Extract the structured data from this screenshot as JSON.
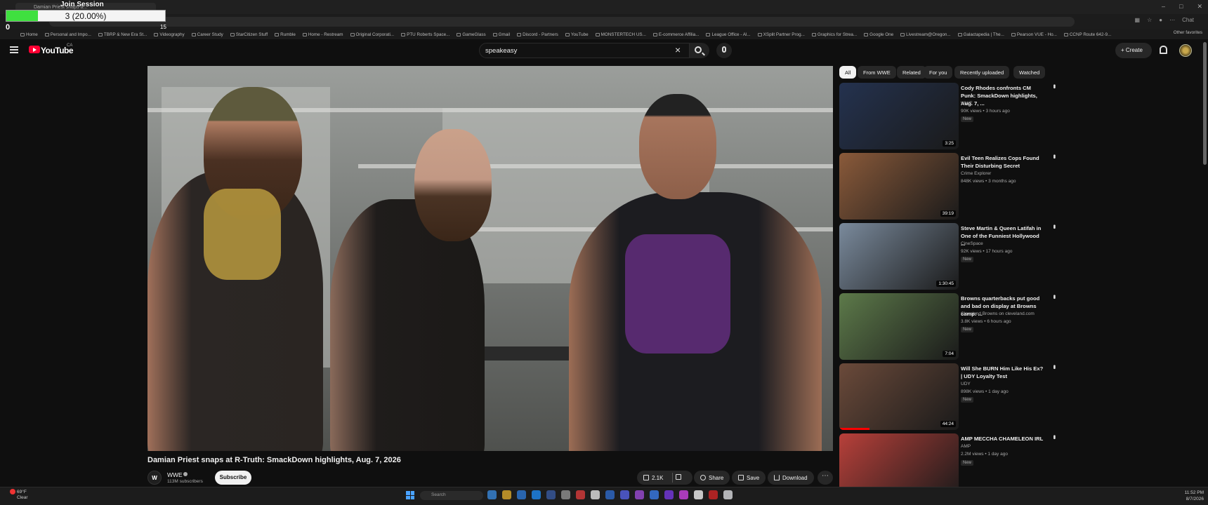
{
  "browser": {
    "tab_title": "Damian Priest snaps a...",
    "bookmarks": [
      "Home",
      "Personal and Impo...",
      "TBRP & New Era St...",
      "Videography",
      "Career Study",
      "StarCitizen Stuff",
      "Rumble",
      "Home - Restream",
      "Original Corporati...",
      "PTU Roberts Space...",
      "GameGlass",
      "Gmail",
      "Discord - Partners",
      "YouTube",
      "MONSTERTECH US...",
      "E-commerce Affilia...",
      "League Office - Al...",
      "XSplit Partner Prog...",
      "Graphics for Strea...",
      "Google One",
      "Livestream@Oregon...",
      "Galactapedia | The...",
      "Pearson VUE - Ho...",
      "CCNP Route 642-9..."
    ],
    "other_bookmarks": "Other favorites",
    "chat_label": "Chat"
  },
  "session": {
    "title": "Join Session",
    "progress_text": "3 (20.00%)",
    "progress_fraction": 0.2,
    "min_label": "0",
    "max_label": "15"
  },
  "youtube": {
    "logo_text": "YouTube",
    "country": "CA",
    "search_query": "speakeasy",
    "create_label": "Create"
  },
  "video": {
    "title": "Damian Priest snaps at R-Truth: SmackDown highlights, Aug. 7, 2026",
    "channel": "WWE",
    "subscribers": "113M subscribers",
    "subscribe_label": "Subscribe",
    "likes": "2.1K",
    "share_label": "Share",
    "save_label": "Save",
    "download_label": "Download"
  },
  "chips": [
    "All",
    "From WWE",
    "Related",
    "For you",
    "Recently uploaded",
    "Watched"
  ],
  "recommendations": [
    {
      "title": "Cody Rhodes confronts CM Punk: SmackDown highlights, Aug. 7, ...",
      "channel": "WWE",
      "meta": "90K views • 3 hours ago",
      "badge": "New",
      "duration": "3:25",
      "thumb_color": "#24324f",
      "watched": 0
    },
    {
      "title": "Evil Teen Realizes Cops Found Their Disturbing Secret",
      "channel": "Crime Explorer",
      "meta": "848K views • 3 months ago",
      "badge": "",
      "duration": "39:19",
      "thumb_color": "#8a5a3a",
      "watched": 0
    },
    {
      "title": "Steve Martin & Queen Latifah in One of the Funniest Hollywood ...",
      "channel": "CineSpace",
      "meta": "92K views • 17 hours ago",
      "badge": "New",
      "duration": "1:30:45",
      "thumb_color": "#7a8a9c",
      "watched": 0
    },
    {
      "title": "Browns quarterbacks put good and bad on display at Browns camp: ...",
      "channel": "Cleveland Browns on cleveland.com",
      "meta": "3.8K views • 6 hours ago",
      "badge": "New",
      "duration": "7:04",
      "thumb_color": "#5d7a4a",
      "watched": 0
    },
    {
      "title": "Will She BURN Him Like His Ex? | UDY Loyalty Test",
      "channel": "UDY",
      "meta": "898K views • 1 day ago",
      "badge": "New",
      "duration": "44:24",
      "thumb_color": "#6b4a3a",
      "watched": 0.25
    },
    {
      "title": "AMP MECCHA CHAMELEON IRL",
      "channel": "AMP",
      "meta": "2.2M views • 1 day ago",
      "badge": "New",
      "duration": "",
      "thumb_color": "#b8403a",
      "watched": 0
    }
  ],
  "taskbar": {
    "weather_temp": "69°F",
    "weather_desc": "Clear",
    "search_placeholder": "Search",
    "time": "11:52 PM",
    "date": "8/7/2026"
  }
}
